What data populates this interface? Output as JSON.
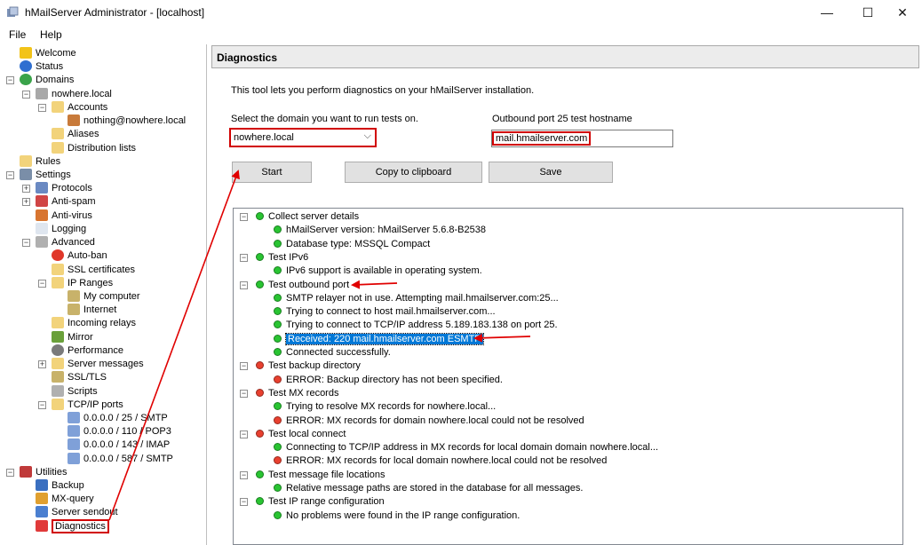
{
  "window": {
    "title": "hMailServer Administrator - [localhost]",
    "minimize": "—",
    "maximize": "☐",
    "close": "✕"
  },
  "menu": {
    "file": "File",
    "help": "Help"
  },
  "tree": [
    {
      "label": "Welcome",
      "icon": "star-icon",
      "color": "#f2c318"
    },
    {
      "label": "Status",
      "icon": "info-icon",
      "color": "#2f6fd0"
    },
    {
      "label": "Domains",
      "icon": "globe-icon",
      "color": "#3aa34a"
    },
    {
      "label": "nowhere.local",
      "icon": "server-icon",
      "color": "#a8a8a8"
    },
    {
      "label": "Accounts",
      "icon": "folder-icon",
      "color": "#f2d37b"
    },
    {
      "label": "nothing@nowhere.local",
      "icon": "user-icon",
      "color": "#c87a3a"
    },
    {
      "label": "Aliases",
      "icon": "folder-icon",
      "color": "#f2d37b"
    },
    {
      "label": "Distribution lists",
      "icon": "folder-icon",
      "color": "#f2d37b"
    },
    {
      "label": "Rules",
      "icon": "folder-icon",
      "color": "#f2d37b"
    },
    {
      "label": "Settings",
      "icon": "tools-icon",
      "color": "#7a8ea8"
    },
    {
      "label": "Protocols",
      "icon": "protocols-icon",
      "color": "#6a89c2"
    },
    {
      "label": "Anti-spam",
      "icon": "antispam-icon",
      "color": "#d04545"
    },
    {
      "label": "Anti-virus",
      "icon": "antivirus-icon",
      "color": "#d87530"
    },
    {
      "label": "Logging",
      "icon": "document-icon",
      "color": "#dfe6ef"
    },
    {
      "label": "Advanced",
      "icon": "magnifier-icon",
      "color": "#b0b0b0"
    },
    {
      "label": "Auto-ban",
      "icon": "ban-icon",
      "color": "#e0372a"
    },
    {
      "label": "SSL certificates",
      "icon": "folder-icon",
      "color": "#f2d37b"
    },
    {
      "label": "IP Ranges",
      "icon": "folder-icon",
      "color": "#f2d37b"
    },
    {
      "label": "My computer",
      "icon": "range-icon",
      "color": "#c8b26a"
    },
    {
      "label": "Internet",
      "icon": "range-icon",
      "color": "#c8b26a"
    },
    {
      "label": "Incoming relays",
      "icon": "folder-icon",
      "color": "#f2d37b"
    },
    {
      "label": "Mirror",
      "icon": "mirror-icon",
      "color": "#6aa03a"
    },
    {
      "label": "Performance",
      "icon": "gauge-icon",
      "color": "#7a7a7a"
    },
    {
      "label": "Server messages",
      "icon": "folder-icon",
      "color": "#f2d37b"
    },
    {
      "label": "SSL/TLS",
      "icon": "range-icon",
      "color": "#c8b26a"
    },
    {
      "label": "Scripts",
      "icon": "script-icon",
      "color": "#b0b0b0"
    },
    {
      "label": "TCP/IP ports",
      "icon": "folder-icon",
      "color": "#f2d37b"
    },
    {
      "label": "0.0.0.0 / 25 / SMTP",
      "icon": "feather-icon",
      "color": "#7fa0d8"
    },
    {
      "label": "0.0.0.0 / 110 / POP3",
      "icon": "feather-icon",
      "color": "#7fa0d8"
    },
    {
      "label": "0.0.0.0 / 143 / IMAP",
      "icon": "feather-icon",
      "color": "#7fa0d8"
    },
    {
      "label": "0.0.0.0 / 587 / SMTP",
      "icon": "feather-icon",
      "color": "#7fa0d8"
    },
    {
      "label": "Utilities",
      "icon": "utilities-icon",
      "color": "#c03a3a"
    },
    {
      "label": "Backup",
      "icon": "floppy-icon",
      "color": "#3a6fc0"
    },
    {
      "label": "MX-query",
      "icon": "mxquery-icon",
      "color": "#e0a030"
    },
    {
      "label": "Server sendout",
      "icon": "sendout-icon",
      "color": "#4a7fd0"
    },
    {
      "label": "Diagnostics",
      "icon": "heart-icon",
      "color": "#e03a3a"
    }
  ],
  "pane": {
    "header": "Diagnostics",
    "intro": "This tool lets you perform diagnostics on your hMailServer installation.",
    "domain_label": "Select the domain you want to run tests on.",
    "domain_value": "nowhere.local",
    "host_label": "Outbound port 25 test hostname",
    "host_value": "mail.hmailserver.com",
    "start": "Start",
    "copy": "Copy to clipboard",
    "save": "Save"
  },
  "results": [
    {
      "label": "Collect server details",
      "status": "green",
      "level": 0
    },
    {
      "label": "hMailServer version: hMailServer 5.6.8-B2538",
      "status": "green",
      "level": 1
    },
    {
      "label": "Database type: MSSQL Compact",
      "status": "green",
      "level": 1
    },
    {
      "label": "Test IPv6",
      "status": "green",
      "level": 0
    },
    {
      "label": "IPv6 support is available in operating system.",
      "status": "green",
      "level": 1
    },
    {
      "label": "Test outbound port",
      "status": "green",
      "level": 0
    },
    {
      "label": "SMTP relayer not in use. Attempting mail.hmailserver.com:25...",
      "status": "green",
      "level": 1
    },
    {
      "label": "Trying to connect to host mail.hmailserver.com...",
      "status": "green",
      "level": 1
    },
    {
      "label": "Trying to connect to TCP/IP address 5.189.183.138 on port 25.",
      "status": "green",
      "level": 1
    },
    {
      "label": "Received: 220 mail.hmailserver.com ESMTP",
      "status": "green",
      "level": 1
    },
    {
      "label": "Connected successfully.",
      "status": "green",
      "level": 1
    },
    {
      "label": "Test backup directory",
      "status": "red",
      "level": 0
    },
    {
      "label": "ERROR: Backup directory has not been specified.",
      "status": "red",
      "level": 1
    },
    {
      "label": "Test MX records",
      "status": "red",
      "level": 0
    },
    {
      "label": "Trying to resolve MX records for nowhere.local...",
      "status": "green",
      "level": 1
    },
    {
      "label": "ERROR: MX records for domain nowhere.local could not be resolved",
      "status": "red",
      "level": 1
    },
    {
      "label": "Test local connect",
      "status": "red",
      "level": 0
    },
    {
      "label": "Connecting to TCP/IP address in MX records for local domain domain nowhere.local...",
      "status": "green",
      "level": 1
    },
    {
      "label": "ERROR: MX records for local domain nowhere.local could not be resolved",
      "status": "red",
      "level": 1
    },
    {
      "label": "Test message file locations",
      "status": "green",
      "level": 0
    },
    {
      "label": "Relative message paths are stored in the database for all messages.",
      "status": "green",
      "level": 1
    },
    {
      "label": "Test IP range configuration",
      "status": "green",
      "level": 0
    },
    {
      "label": "No problems were found in the IP range configuration.",
      "status": "green",
      "level": 1
    }
  ],
  "colors": {
    "green": "#29c432",
    "red": "#e8402f",
    "annotation": "#e00000",
    "selection": "#0078d7"
  }
}
